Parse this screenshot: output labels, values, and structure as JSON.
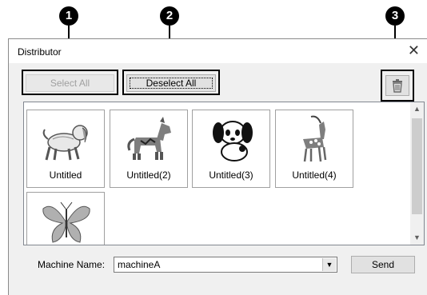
{
  "callouts": [
    "1",
    "2",
    "3"
  ],
  "dialog": {
    "title": "Distributor",
    "close_glyph": "✕"
  },
  "toolbar": {
    "select_all_label": "Select All",
    "select_all_enabled": false,
    "deselect_all_label": "Deselect All",
    "delete_icon": "trash-icon"
  },
  "items": [
    {
      "label": "Untitled",
      "icon": "dog-embroidery"
    },
    {
      "label": "Untitled(2)",
      "icon": "horse-embroidery"
    },
    {
      "label": "Untitled(3)",
      "icon": "puppy-embroidery"
    },
    {
      "label": "Untitled(4)",
      "icon": "goat-embroidery"
    },
    {
      "label": "",
      "icon": "butterfly-embroidery"
    }
  ],
  "machine": {
    "label": "Machine Name:",
    "value": "machineA"
  },
  "send_label": "Send"
}
